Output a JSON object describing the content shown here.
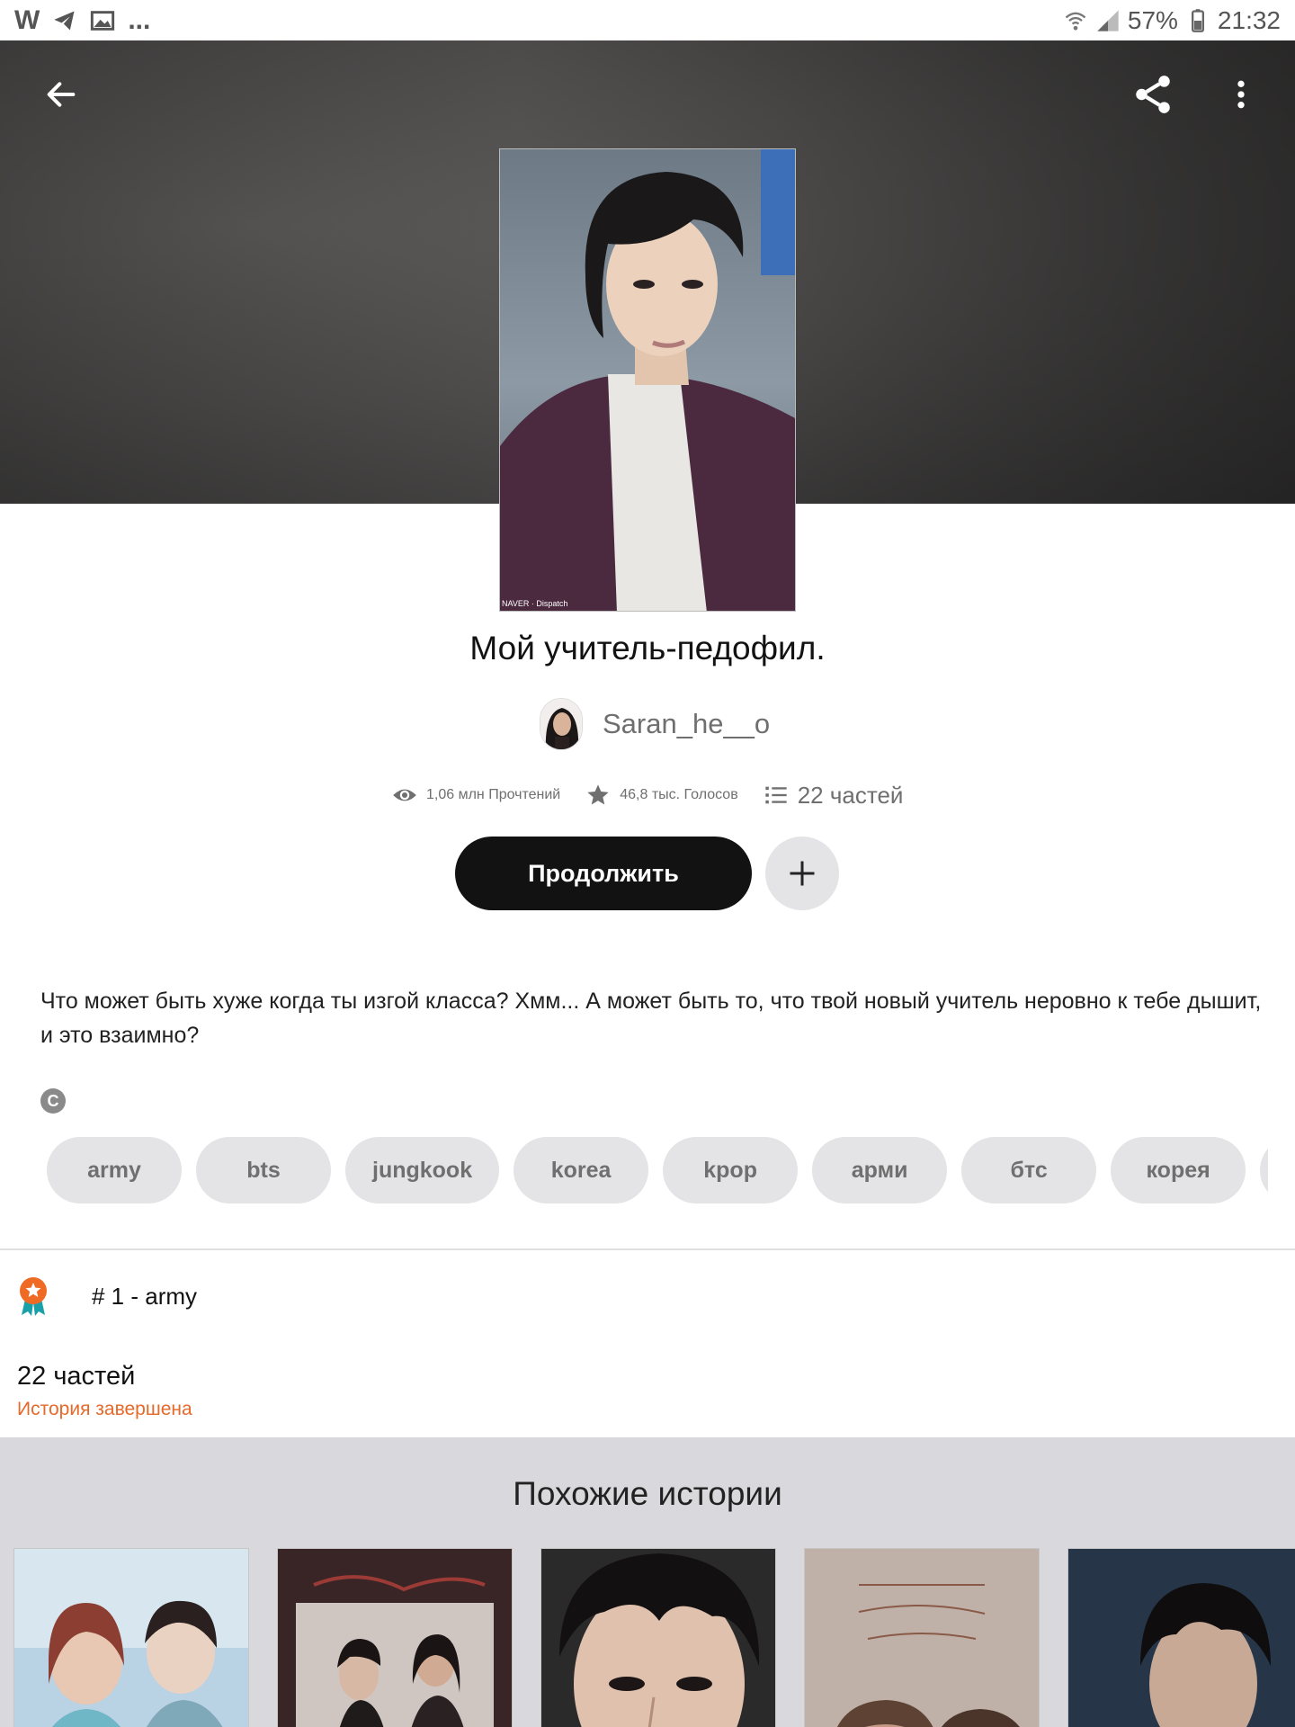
{
  "status_bar": {
    "left_glyphs": [
      "W",
      "..."
    ],
    "battery": "57%",
    "time": "21:32"
  },
  "icons": {
    "back": "arrow-left-icon",
    "share": "share-icon",
    "more": "more-vertical-icon",
    "reads": "eye-icon",
    "votes": "star-icon",
    "parts": "list-icon",
    "add": "plus-icon",
    "copyright": "copyright-icon",
    "rank": "ribbon-badge-icon"
  },
  "story": {
    "title": "Мой учитель-педофил.",
    "author": "Saran_he__o",
    "reads": "1,06 млн Прочтений",
    "votes": "46,8 тыс. Голосов",
    "parts": "22 частей",
    "continue_label": "Продолжить",
    "description": "Что может быть хуже когда ты изгой класса? Хмм... А может быть то, что твой новый учитель неровно к тебе дышит, и это взаимно?",
    "copyright_glyph": "C",
    "tags": [
      "army",
      "bts",
      "jungkook",
      "korea",
      "kpop",
      "арми",
      "бтс",
      "корея",
      ""
    ]
  },
  "ranking": {
    "text": "# 1 - army"
  },
  "toc": {
    "parts_count": "22 частей",
    "status": "История завершена"
  },
  "similar": {
    "title": "Похожие истории"
  },
  "colors": {
    "accent_orange": "#e6692a",
    "button_dark": "#121212",
    "chip_bg": "#e4e4e6",
    "similar_bg": "#d9d8dc"
  }
}
